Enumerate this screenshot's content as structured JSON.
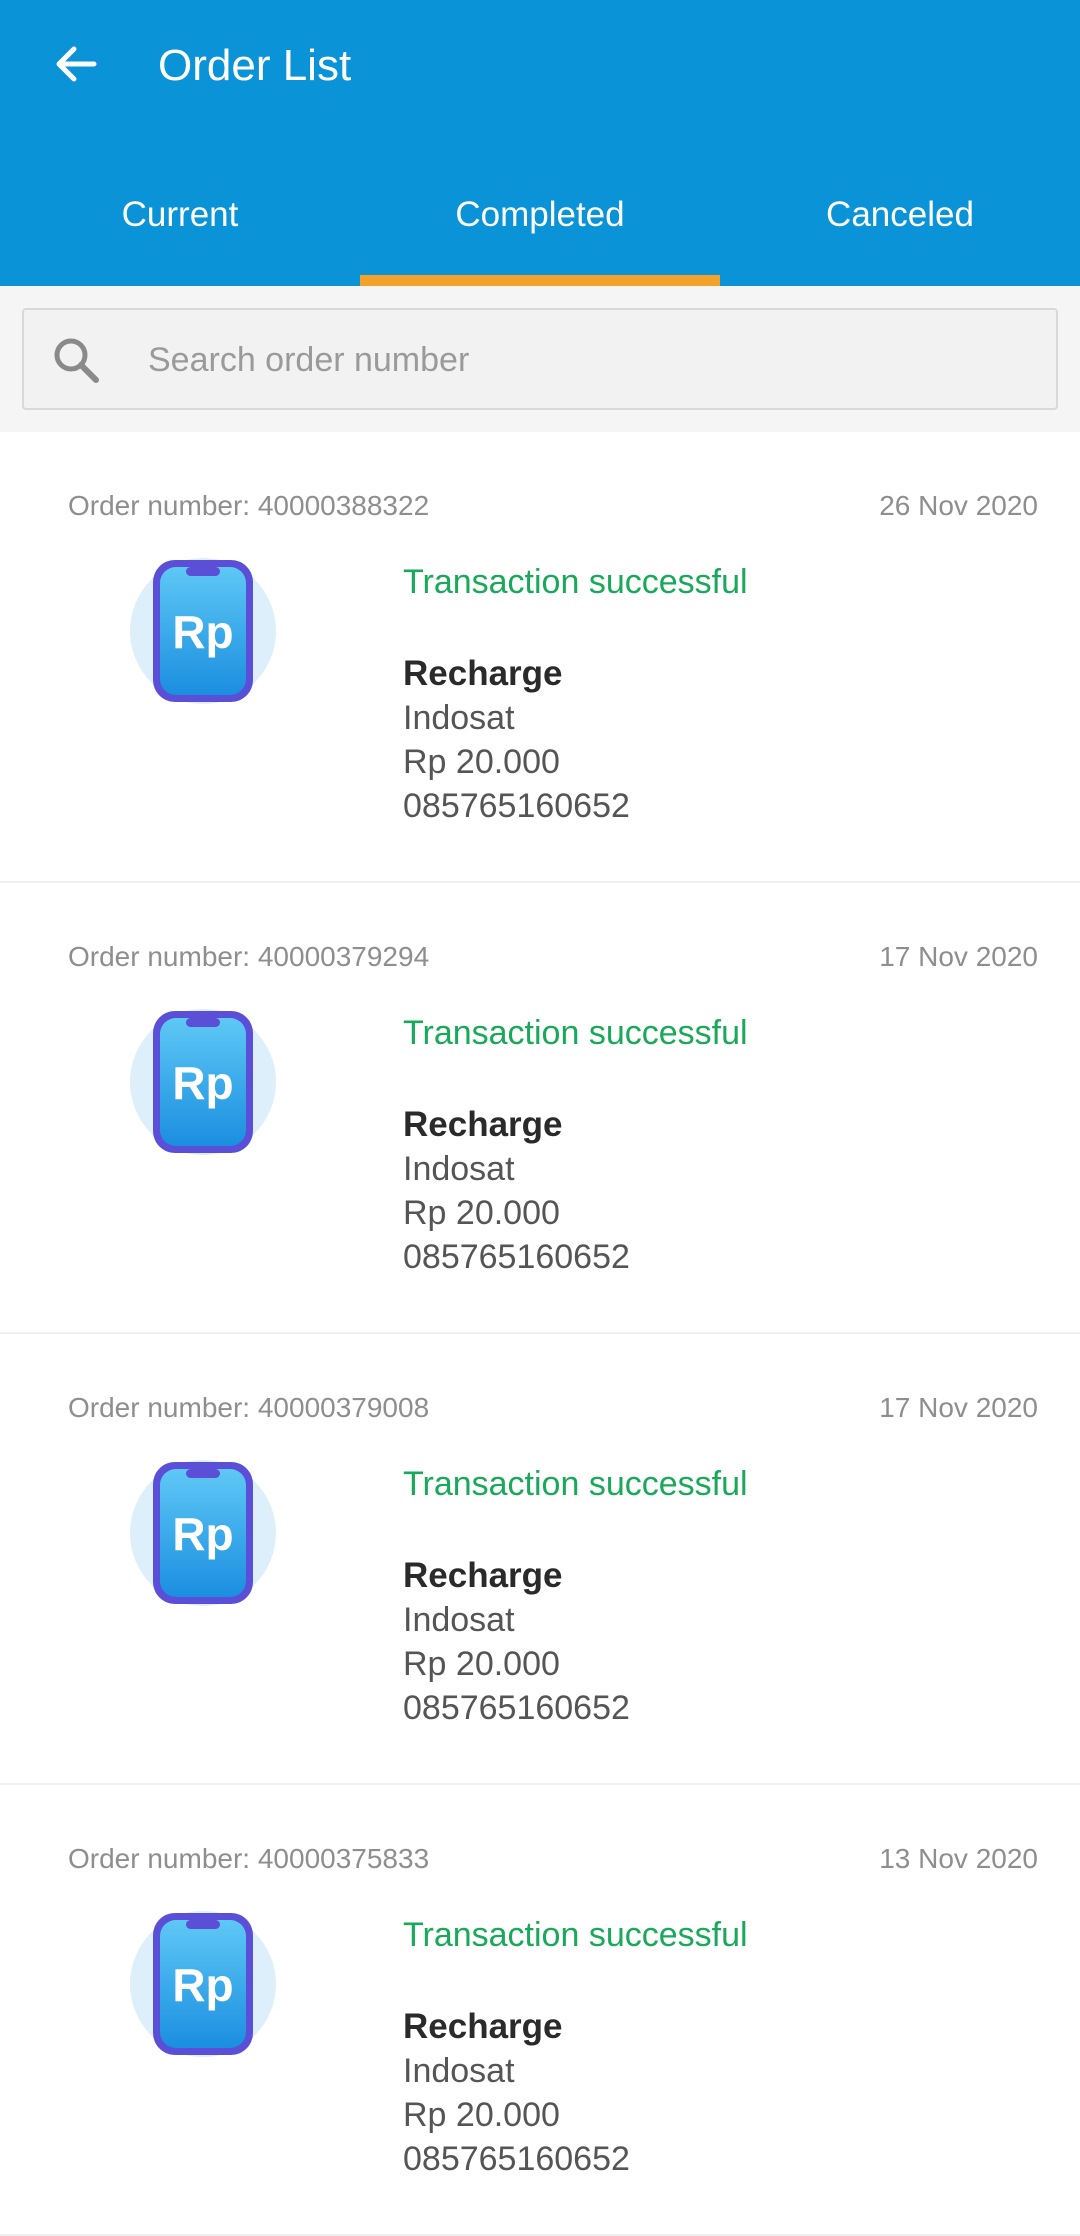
{
  "header": {
    "title": "Order List",
    "back_icon": "arrow-left-icon"
  },
  "tabs": [
    {
      "label": "Current",
      "active": false
    },
    {
      "label": "Completed",
      "active": true
    },
    {
      "label": "Canceled",
      "active": false
    }
  ],
  "search": {
    "placeholder": "Search order number",
    "icon": "search-icon"
  },
  "colors": {
    "accent": "#0a93d6",
    "tab_indicator": "#f4a12a",
    "success": "#1aa85a"
  },
  "orders": [
    {
      "order_number": "Order number: 40000388322",
      "date": "26 Nov 2020",
      "status": "Transaction successful",
      "type": "Recharge",
      "operator": "Indosat",
      "amount": "Rp 20.000",
      "phone": "085765160652",
      "icon_label": "Rp"
    },
    {
      "order_number": "Order number: 40000379294",
      "date": "17 Nov 2020",
      "status": "Transaction successful",
      "type": "Recharge",
      "operator": "Indosat",
      "amount": "Rp 20.000",
      "phone": "085765160652",
      "icon_label": "Rp"
    },
    {
      "order_number": "Order number: 40000379008",
      "date": "17 Nov 2020",
      "status": "Transaction successful",
      "type": "Recharge",
      "operator": "Indosat",
      "amount": "Rp 20.000",
      "phone": "085765160652",
      "icon_label": "Rp"
    },
    {
      "order_number": "Order number: 40000375833",
      "date": "13 Nov 2020",
      "status": "Transaction successful",
      "type": "Recharge",
      "operator": "Indosat",
      "amount": "Rp 20.000",
      "phone": "085765160652",
      "icon_label": "Rp"
    }
  ]
}
